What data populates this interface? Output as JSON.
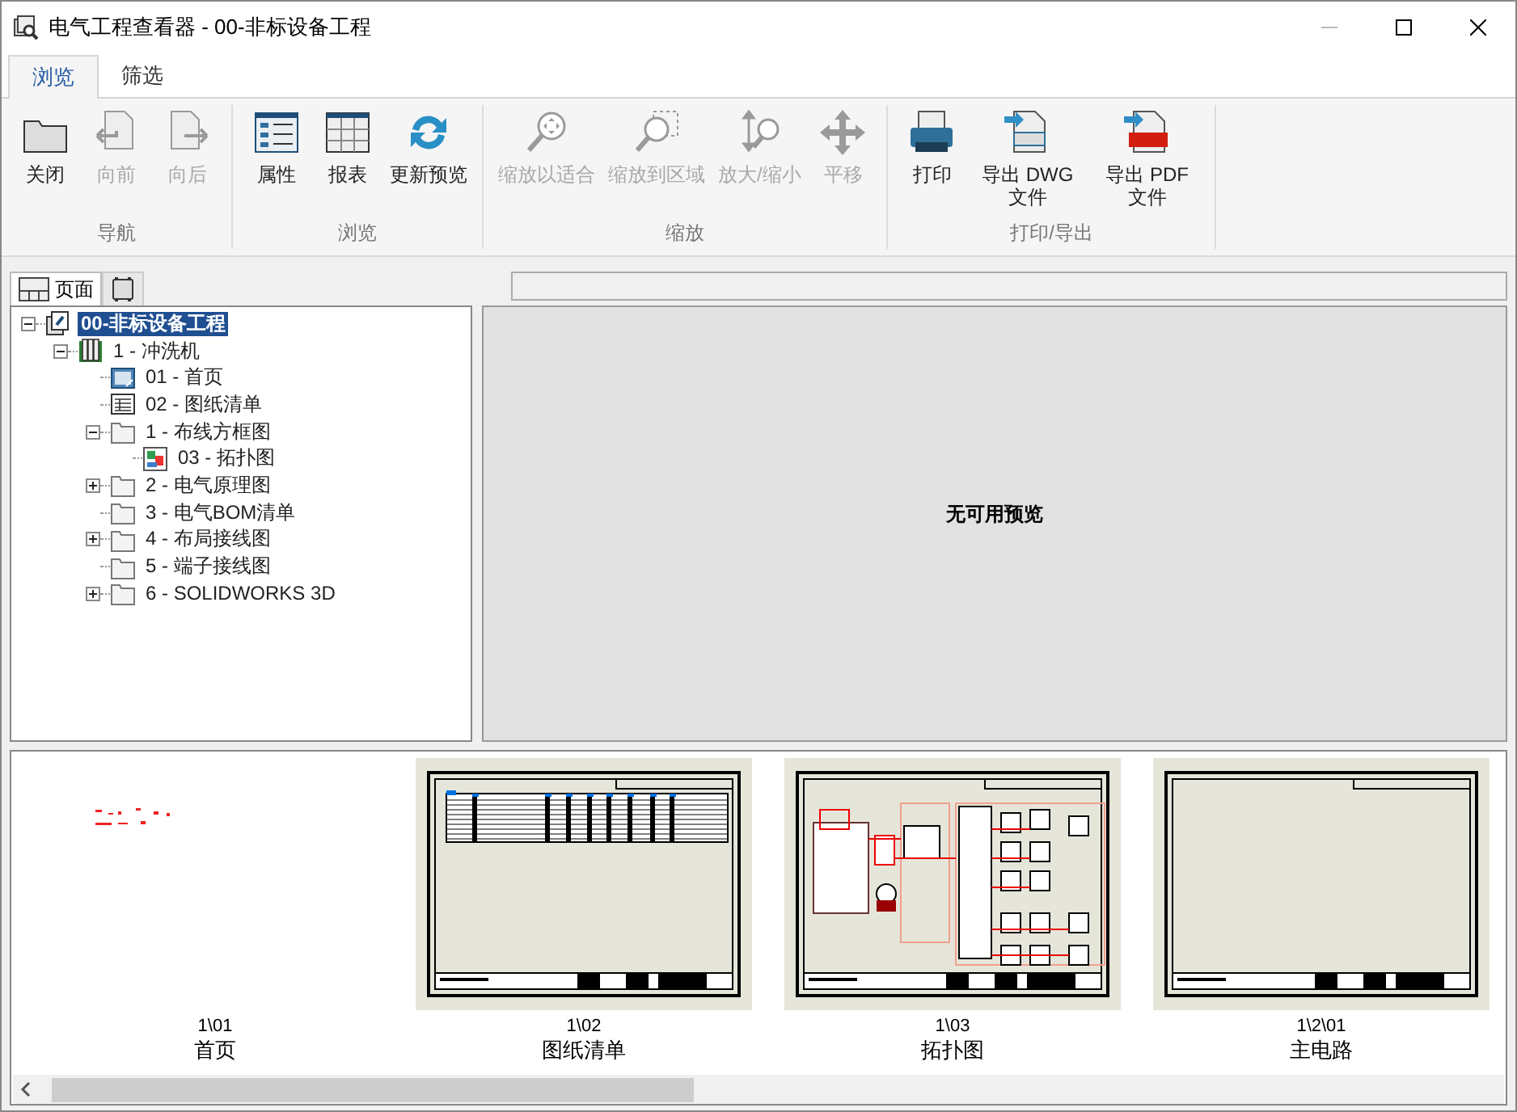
{
  "window": {
    "title": "电气工程查看器 - 00-非标设备工程"
  },
  "tabs": [
    {
      "label": "浏览",
      "selected": true
    },
    {
      "label": "筛选",
      "selected": false
    }
  ],
  "ribbon": {
    "groups": [
      {
        "label": "导航",
        "buttons": [
          {
            "kind": "close",
            "label": "关闭",
            "disabled": false
          },
          {
            "kind": "back",
            "label": "向前",
            "disabled": true
          },
          {
            "kind": "forward",
            "label": "向后",
            "disabled": true
          }
        ]
      },
      {
        "label": "浏览",
        "buttons": [
          {
            "kind": "properties",
            "label": "属性",
            "disabled": false
          },
          {
            "kind": "report",
            "label": "报表",
            "disabled": false
          },
          {
            "kind": "refresh",
            "label": "更新预览",
            "disabled": false
          }
        ]
      },
      {
        "label": "缩放",
        "buttons": [
          {
            "kind": "zoom_fit",
            "label": "缩放以适合",
            "disabled": true
          },
          {
            "kind": "zoom_area",
            "label": "缩放到区域",
            "disabled": true
          },
          {
            "kind": "zoom",
            "label": "放大/缩小",
            "disabled": true
          },
          {
            "kind": "pan",
            "label": "平移",
            "disabled": true
          }
        ]
      },
      {
        "label": "打印/导出",
        "buttons": [
          {
            "kind": "print",
            "label": "打印",
            "disabled": false
          },
          {
            "kind": "dwg",
            "label": "导出 DWG 文件",
            "disabled": false
          },
          {
            "kind": "pdf",
            "label": "导出 PDF 文件",
            "disabled": false
          }
        ]
      }
    ]
  },
  "pane_tabs": [
    {
      "kind": "pages",
      "label": "页面",
      "selected": true
    },
    {
      "kind": "devices",
      "selected": false
    }
  ],
  "tree": {
    "kind": "project",
    "label": "00-非标设备工程",
    "expanded": true,
    "selected": true,
    "children": [
      {
        "kind": "machine",
        "label": "1 - 冲洗机",
        "expanded": true,
        "selected": false,
        "children": [
          {
            "kind": "cover",
            "label": "01 - 首页",
            "selected": false
          },
          {
            "kind": "list",
            "label": "02 - 图纸清单",
            "selected": false
          },
          {
            "kind": "folder",
            "label": "1 - 布线方框图",
            "expanded": true,
            "selected": false,
            "children": [
              {
                "kind": "drawing",
                "label": "03 - 拓扑图",
                "selected": false
              }
            ]
          },
          {
            "kind": "folder",
            "label": "2 - 电气原理图",
            "expanded": false,
            "selected": false
          },
          {
            "kind": "folder",
            "label": "3 - 电气BOM清单",
            "selected": false
          },
          {
            "kind": "folder",
            "label": "4 - 布局接线图",
            "expanded": false,
            "selected": false
          },
          {
            "kind": "folder",
            "label": "5 - 端子接线图",
            "selected": false
          },
          {
            "kind": "folder",
            "label": "6 - SOLIDWORKS 3D",
            "expanded": false,
            "selected": false
          }
        ]
      }
    ]
  },
  "preview": {
    "message": "无可用预览"
  },
  "thumbnails": [
    {
      "kind": "cover",
      "number": "1\\01",
      "title": "首页"
    },
    {
      "kind": "list",
      "number": "1\\02",
      "title": "图纸清单"
    },
    {
      "kind": "topology",
      "number": "1\\03",
      "title": "拓扑图"
    },
    {
      "kind": "blank",
      "number": "1\\2\\01",
      "title": "主电路"
    }
  ]
}
